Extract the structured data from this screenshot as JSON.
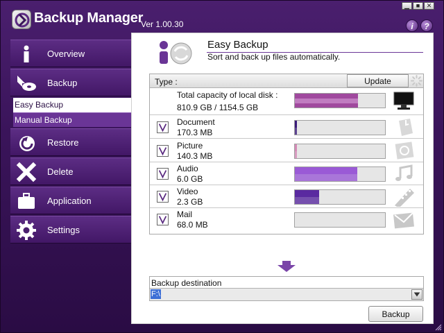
{
  "window": {
    "title": "Backup Manager",
    "version": "Ver 1.00.30",
    "minimize_glyph": "▁",
    "maximize_glyph": "■",
    "close_glyph": "✕",
    "info_label": "i",
    "help_label": "?"
  },
  "sidebar": {
    "items": [
      {
        "label": "Overview",
        "icon": "info-icon"
      },
      {
        "label": "Backup",
        "icon": "backup-icon"
      },
      {
        "label": "Restore",
        "icon": "restore-icon"
      },
      {
        "label": "Delete",
        "icon": "delete-icon"
      },
      {
        "label": "Application",
        "icon": "briefcase-icon"
      },
      {
        "label": "Settings",
        "icon": "gear-icon"
      }
    ],
    "subitems": [
      {
        "label": "Easy Backup",
        "selected": true
      },
      {
        "label": "Manual Backup",
        "selected": false
      }
    ]
  },
  "main": {
    "title": "Easy Backup",
    "subtitle": "Sort and back up files automatically.",
    "list": {
      "type_label": "Type :",
      "update_label": "Update",
      "total": {
        "label": "Total capacity of local disk :",
        "value": "810.9 GB / 1154.5 GB",
        "fraction": 0.702,
        "icon": "monitor-icon"
      },
      "rows": [
        {
          "name": "Document",
          "size": "170.3 MB",
          "checked": true,
          "fraction": 0.02,
          "icon": "document-icon"
        },
        {
          "name": "Picture",
          "size": "140.3 MB",
          "checked": true,
          "fraction": 0.02,
          "icon": "picture-icon"
        },
        {
          "name": "Audio",
          "size": "6.0 GB",
          "checked": true,
          "fraction": 0.69,
          "icon": "music-note-icon"
        },
        {
          "name": "Video",
          "size": "2.3 GB",
          "checked": true,
          "fraction": 0.27,
          "icon": "film-icon"
        },
        {
          "name": "Mail",
          "size": "68.0 MB",
          "checked": true,
          "fraction": 0.0,
          "icon": "envelope-icon"
        }
      ]
    },
    "destination": {
      "label": "Backup destination",
      "value": "F:\\"
    },
    "backup_label": "Backup"
  },
  "colors": {
    "accent": "#5a2a80",
    "sidebar_dark": "#421766",
    "check_mark": "#5a2a80",
    "bar_total": "#a0499e",
    "bar_document": "#3a1a7a",
    "bar_picture": "#d48ab6",
    "bar_audio": "#9a5ad6",
    "bar_video": "#5a2aa0"
  }
}
